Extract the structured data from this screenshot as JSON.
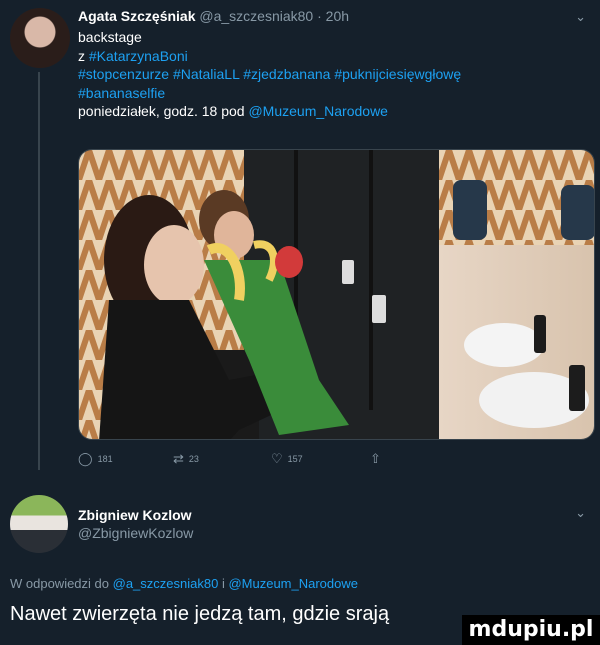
{
  "tweet": {
    "author_name": "Agata Szczęśniak",
    "author_handle": "@a_szczesniak80",
    "separator": "·",
    "time": "20h",
    "lines": [
      "backstage",
      "z ",
      "#stopcenzurze #NataliaLL #zjedzbanana #puknijciesięwgłowę",
      "#bananaselfie",
      "poniedziałek, godz. 18 pod "
    ],
    "mention_boni": "#KatarzynaBoni",
    "mention_museum": "@Muzeum_Narodowe",
    "actions": {
      "reply_count": "181",
      "retweet_count": "23",
      "like_count": "157"
    }
  },
  "reply": {
    "author_name": "Zbigniew Kozlow",
    "author_handle": "@ZbigniewKozlow",
    "in_reply_prefix": "W odpowiedzi do ",
    "in_reply_mention1": "@a_szczesniak80",
    "in_reply_join": " i ",
    "in_reply_mention2": "@Muzeum_Narodowe",
    "text": "Nawet zwierzęta nie jedzą tam, gdzie srają"
  },
  "watermark": "mdupiu.pl",
  "icons": {
    "reply": "reply-icon",
    "retweet": "retweet-icon",
    "like": "heart-icon",
    "share": "share-icon",
    "chevron": "chevron-down-icon"
  }
}
